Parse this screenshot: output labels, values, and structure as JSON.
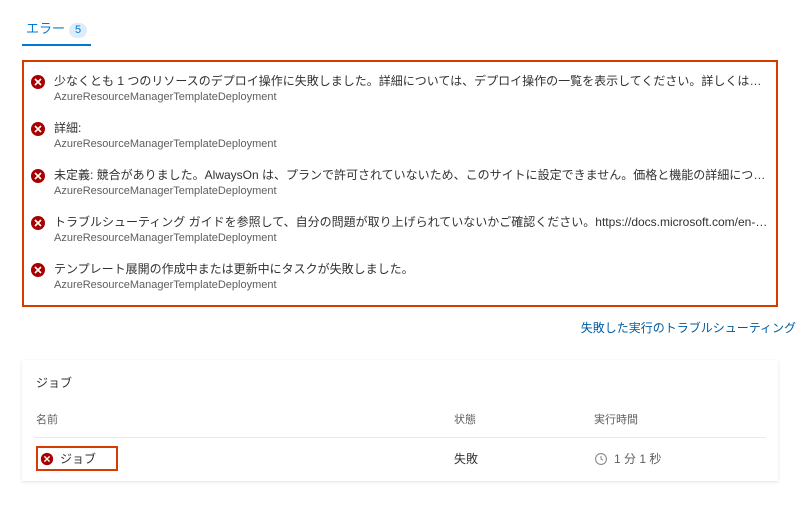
{
  "tab": {
    "label": "エラー",
    "count": "5"
  },
  "error_source": "AzureResourceManagerTemplateDeployment",
  "errors": [
    {
      "msg": "少なくとも 1 つのリソースのデプロイ操作に失敗しました。詳細については、デプロイ操作の一覧を表示してください。詳しくは、https://aka.ms/DeployOpe..."
    },
    {
      "msg": "詳細:"
    },
    {
      "msg": "未定義: 競合がありました。AlwaysOn は、プランで許可されていないため、このサイトに設定できません。価格と機能の詳細について..."
    },
    {
      "msg": "トラブルシューティング ガイドを参照して、自分の問題が取り上げられていないかご確認ください。https://docs.microsoft.com/en-us/azure/devops/pipelines/tasks/..."
    },
    {
      "msg": "テンプレート展開の作成中または更新中にタスクが失敗しました。"
    }
  ],
  "troubleshoot_link": "失敗した実行のトラブルシューティング",
  "jobs": {
    "title": "ジョブ",
    "headers": {
      "name": "名前",
      "status": "状態",
      "duration": "実行時間"
    },
    "rows": [
      {
        "name": "ジョブ",
        "status": "失敗",
        "duration": "1 分 1 秒"
      }
    ]
  }
}
